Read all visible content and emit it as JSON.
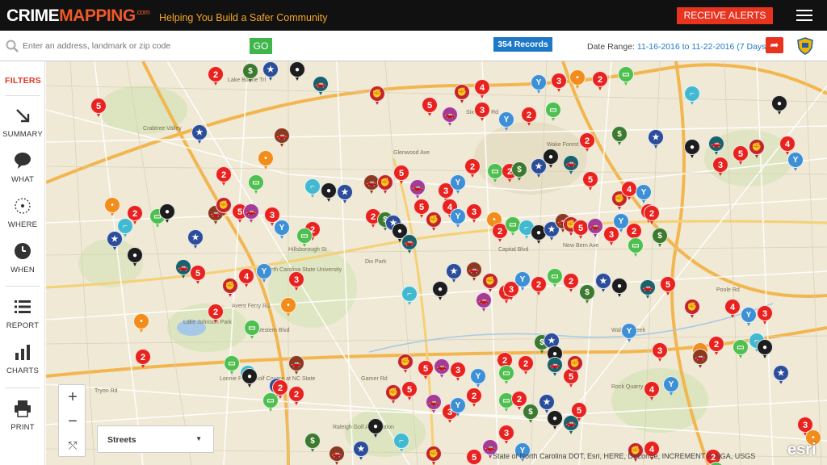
{
  "header": {
    "logo_crime": "CRIME",
    "logo_mapping": "MAPPING",
    "logo_dotcom": ".com",
    "tagline": "Helping You Build a Safer Community",
    "alerts_label": "RECEIVE ALERTS"
  },
  "search": {
    "placeholder": "Enter an address, landmark or zip code",
    "go_label": "GO",
    "records_label": "354 Records",
    "date_range_label": "Date Range:",
    "date_range_value": "11-16-2016 to 11-22-2016 (7 Days)"
  },
  "sidebar": {
    "filters_label": "FILTERS",
    "items": [
      {
        "label": "SUMMARY",
        "icon": "summary-arrow-icon"
      },
      {
        "label": "WHAT",
        "icon": "speech-bubble-icon"
      },
      {
        "label": "WHERE",
        "icon": "target-icon"
      },
      {
        "label": "WHEN",
        "icon": "clock-icon"
      },
      {
        "label": "REPORT",
        "icon": "list-icon"
      },
      {
        "label": "CHARTS",
        "icon": "bar-chart-icon"
      },
      {
        "label": "PRINT",
        "icon": "printer-icon"
      }
    ]
  },
  "map": {
    "basemap_label": "Streets",
    "attribution": "State of North Carolina DOT, Esri, HERE, DeLorme, INCREMENT P, NGA, USGS",
    "esri_label": "esri",
    "zoom_in": "+",
    "zoom_out": "−",
    "labels": [
      "Glenwood Ave",
      "Six Forks Rd",
      "Wake Forest Rd",
      "Capital Blvd",
      "Hillsborough St",
      "Western Blvd",
      "North Carolina State University",
      "Dix Park",
      "Lake Johnson Park",
      "Walnut Creek",
      "New Bern Ave",
      "Poole Rd",
      "Crabtree Valley",
      "Lake Boone Trl",
      "Raleigh Golf Association",
      "Lonnie Poole Golf Course at NC State",
      "Rock Quarry Rd",
      "Tryon Rd",
      "Garner Rd",
      "Avent Ferry Rd"
    ],
    "pins": [
      {
        "t": "2",
        "c": "#e8231f"
      },
      {
        "t": "2",
        "c": "#e8231f"
      },
      {
        "t": "3",
        "c": "#e8231f"
      },
      {
        "t": "4",
        "c": "#e8231f"
      },
      {
        "t": "5",
        "c": "#e8231f"
      },
      {
        "t": "",
        "c": "#8a3a1e",
        "i": "car"
      },
      {
        "t": "",
        "c": "#1d1d1d",
        "i": "mask"
      },
      {
        "t": "",
        "c": "#3d7a2f",
        "i": "dollar"
      },
      {
        "t": "",
        "c": "#4fbf4f",
        "i": "card"
      },
      {
        "t": "",
        "c": "#f28c1a",
        "i": "bottle"
      },
      {
        "t": "",
        "c": "#3d8fd6",
        "i": "cocktail"
      },
      {
        "t": "",
        "c": "#a53b98",
        "i": "car"
      },
      {
        "t": "",
        "c": "#c2252b",
        "i": "fist"
      },
      {
        "t": "",
        "c": "#18626b",
        "i": "car"
      },
      {
        "t": "",
        "c": "#2c4d9a",
        "i": "police"
      },
      {
        "t": "",
        "c": "#42b9d1",
        "i": "gun"
      }
    ]
  }
}
